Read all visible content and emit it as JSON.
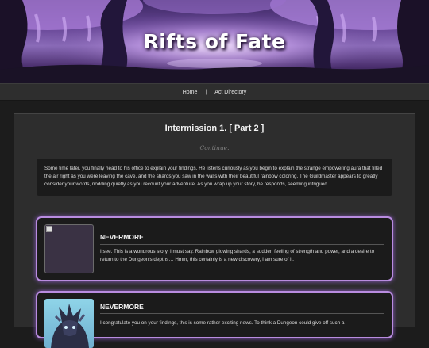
{
  "header": {
    "title": "Rifts of Fate"
  },
  "nav": {
    "items": [
      {
        "label": "Home"
      },
      {
        "label": "Act Directory"
      }
    ],
    "separator": "|"
  },
  "main": {
    "title": "Intermission 1. [ Part 2 ]",
    "continue_label": "Continue.",
    "narration": "Some time later, you finally head to his office to explain your findings. He listens curiously as you begin to explain the strange empowering aura that filled the air right as you were leaving the cave, and the shards you saw in the walls with their beautiful rainbow coloring. The Guildmaster appears to greatly consider your words, nodding quietly as you recount your adventure. As you wrap up your story, he responds, seeming intrigued.",
    "dialogs": [
      {
        "speaker": "NEVERMORE",
        "text": "I see. This is a wondrous story, I must say. Rainbow glowing shards, a sudden feeling of strength and power, and a desire to return to the Dungeon's depths… Hmm, this certainly is a new discovery, I am sure of it."
      },
      {
        "speaker": "NEVERMORE",
        "text": "I congratulate you on your findings, this is some rather exciting news. To think a Dungeon could give off such a"
      }
    ]
  },
  "colors": {
    "accent": "#b98ce0",
    "background": "#1c1c1c",
    "panel": "#2d2d2d"
  }
}
